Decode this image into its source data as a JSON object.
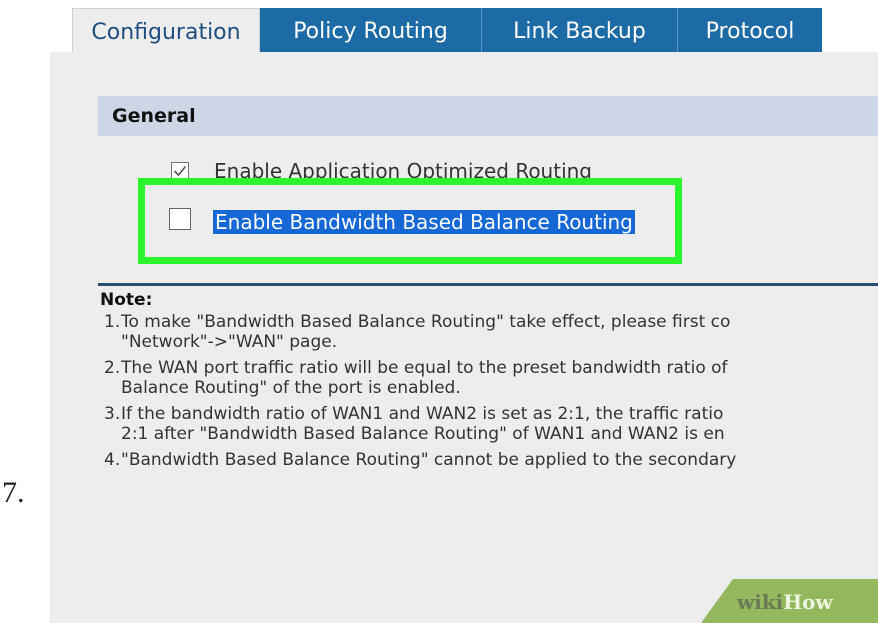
{
  "step": {
    "number": "7."
  },
  "tabs": [
    {
      "label": "Configuration",
      "active": true
    },
    {
      "label": "Policy Routing",
      "active": false
    },
    {
      "label": "Link Backup",
      "active": false
    },
    {
      "label": "Protocol",
      "active": false
    }
  ],
  "general": {
    "title": "General",
    "options": [
      {
        "label": "Enable Application Optimized Routing",
        "checked": true
      },
      {
        "label": "Enable Bandwidth Based Balance Routing",
        "checked": false,
        "selected": true
      }
    ]
  },
  "note": {
    "title": "Note:",
    "items": [
      {
        "number": "1.",
        "text": "To make \"Bandwidth Based Balance Routing\" take effect, please first co\n\"Network\"->\"WAN\" page."
      },
      {
        "number": "2.",
        "text": "The WAN port traffic ratio will be equal to the preset bandwidth ratio of\nBalance Routing\" of the port is enabled."
      },
      {
        "number": "3.",
        "text": "If the bandwidth ratio of WAN1 and WAN2 is set as 2:1, the traffic ratio\n2:1 after \"Bandwidth Based Balance Routing\" of WAN1 and WAN2 is en"
      },
      {
        "number": "4.",
        "text": "\"Bandwidth Based Balance Routing\" cannot be applied to the secondary"
      }
    ]
  },
  "watermark": {
    "part1": "wiki",
    "part2": "How"
  },
  "colors": {
    "tab_active_text": "#1e4e80",
    "tab_inactive_bg": "#1c6aa6",
    "section_header_bg": "#cdd6e6",
    "highlight_border": "#2bf52b",
    "selection_bg": "#1668d6",
    "divider": "#2a4e74",
    "watermark_bg": "#93b85e"
  }
}
